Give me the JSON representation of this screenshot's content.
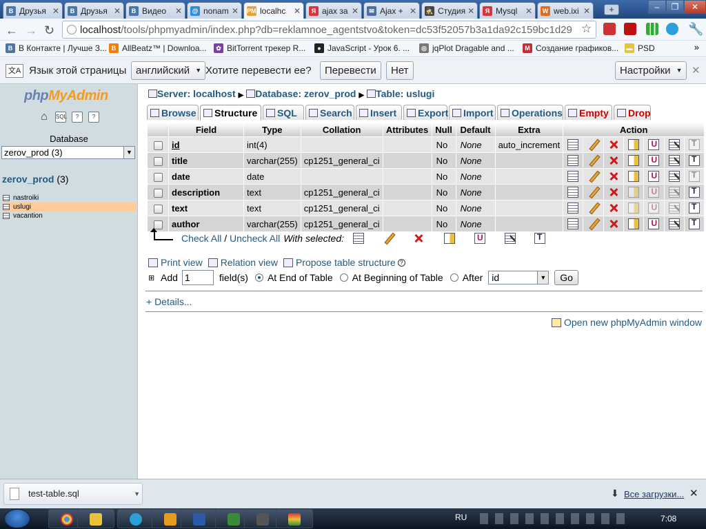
{
  "browser": {
    "tabs": [
      {
        "label": "Друзья",
        "favicon": "B",
        "color": "#4a76a8"
      },
      {
        "label": "Друзья",
        "favicon": "B",
        "color": "#4a76a8"
      },
      {
        "label": "Видео",
        "favicon": "B",
        "color": "#4a76a8"
      },
      {
        "label": "nonam",
        "favicon": "@",
        "color": "#2f8fd8"
      },
      {
        "label": "localhc",
        "favicon": "PMA",
        "color": "#e8a23a"
      },
      {
        "label": "ajax за",
        "favicon": "Я",
        "color": "#d9343c"
      },
      {
        "label": "Ajax +",
        "favicon": "✉",
        "color": "#4d6f9f"
      },
      {
        "label": "Студия",
        "favicon": "🕵",
        "color": "#444444"
      },
      {
        "label": "Mysql",
        "favicon": "Я",
        "color": "#d9343c"
      },
      {
        "label": "web.ixi",
        "favicon": "W",
        "color": "#e26b1e"
      }
    ],
    "url_host": "localhost",
    "url_path": "/tools/phpmyadmin/index.php?db=reklamnoe_agentstvo&token=dc53f52057b3a1da92c159bc1d29",
    "bookmarks": [
      {
        "label": "В Контакте | Лучше З...",
        "icon": "B",
        "color": "#4a76a8"
      },
      {
        "label": "AllBeatz™ | Downloa...",
        "icon": "B",
        "color": "#f57d00"
      },
      {
        "label": "BitTorrent трекер R...",
        "icon": "✿",
        "color": "#7a3fa0"
      },
      {
        "label": "JavaScript - Урок 6. ...",
        "icon": "●",
        "color": "#222222"
      },
      {
        "label": "jqPlot Dragable and ...",
        "icon": "◎",
        "color": "#777777"
      },
      {
        "label": "Создание графиков...",
        "icon": "M",
        "color": "#c23030"
      },
      {
        "label": "PSD",
        "icon": "▬",
        "color": "#e8c23a"
      }
    ]
  },
  "translate": {
    "prompt": "Язык этой страницы",
    "language": "английский",
    "question": "Хотите перевести ее?",
    "translate_btn": "Перевести",
    "no_btn": "Нет",
    "settings_btn": "Настройки"
  },
  "nav": {
    "logo_php": "php",
    "logo_my": "My",
    "logo_admin": "Admin",
    "database_label": "Database",
    "database_selected": "zerov_prod (3)",
    "db_name": "zerov_prod",
    "db_count": "(3)",
    "tables": [
      "nastroiki",
      "uslugi",
      "vacantion"
    ],
    "selected_table": "uslugi"
  },
  "main": {
    "breadcrumb": {
      "server": "Server: localhost",
      "database": "Database: zerov_prod",
      "table": "Table: uslugi"
    },
    "tabs": [
      {
        "label": "Browse",
        "danger": false
      },
      {
        "label": "Structure",
        "danger": false
      },
      {
        "label": "SQL",
        "danger": false
      },
      {
        "label": "Search",
        "danger": false
      },
      {
        "label": "Insert",
        "danger": false
      },
      {
        "label": "Export",
        "danger": false
      },
      {
        "label": "Import",
        "danger": false
      },
      {
        "label": "Operations",
        "danger": false
      },
      {
        "label": "Empty",
        "danger": true
      },
      {
        "label": "Drop",
        "danger": true
      }
    ],
    "active_tab": "Structure",
    "columns": [
      "Field",
      "Type",
      "Collation",
      "Attributes",
      "Null",
      "Default",
      "Extra",
      "Action"
    ],
    "rows": [
      {
        "field": "id",
        "type": "int(4)",
        "collation": "",
        "attributes": "",
        "null": "No",
        "default": "None",
        "extra": "auto_increment",
        "primary": true
      },
      {
        "field": "title",
        "type": "varchar(255)",
        "collation": "cp1251_general_ci",
        "attributes": "",
        "null": "No",
        "default": "None",
        "extra": "",
        "primary": false
      },
      {
        "field": "date",
        "type": "date",
        "collation": "",
        "attributes": "",
        "null": "No",
        "default": "None",
        "extra": "",
        "primary": false
      },
      {
        "field": "description",
        "type": "text",
        "collation": "cp1251_general_ci",
        "attributes": "",
        "null": "No",
        "default": "None",
        "extra": "",
        "primary": false
      },
      {
        "field": "text",
        "type": "text",
        "collation": "cp1251_general_ci",
        "attributes": "",
        "null": "No",
        "default": "None",
        "extra": "",
        "primary": false
      },
      {
        "field": "author",
        "type": "varchar(255)",
        "collation": "cp1251_general_ci",
        "attributes": "",
        "null": "No",
        "default": "None",
        "extra": "",
        "primary": false
      }
    ],
    "check_all": "Check All",
    "separator": " / ",
    "uncheck_all": "Uncheck All",
    "with_selected": "With selected:",
    "print_view": "Print view",
    "relation_view": "Relation view",
    "propose_structure": "Propose table structure",
    "add_label": "Add",
    "add_count": "1",
    "fields_label": "field(s)",
    "at_end": "At End of Table",
    "at_beginning": "At Beginning of Table",
    "after_label": "After",
    "after_value": "id",
    "go_btn": "Go",
    "details": "+ Details...",
    "open_window": "Open new phpMyAdmin window"
  },
  "downloads": {
    "file": "test-table.sql",
    "all_downloads": "Все загрузки..."
  },
  "taskbar": {
    "lang": "RU",
    "clock": "7:08"
  }
}
